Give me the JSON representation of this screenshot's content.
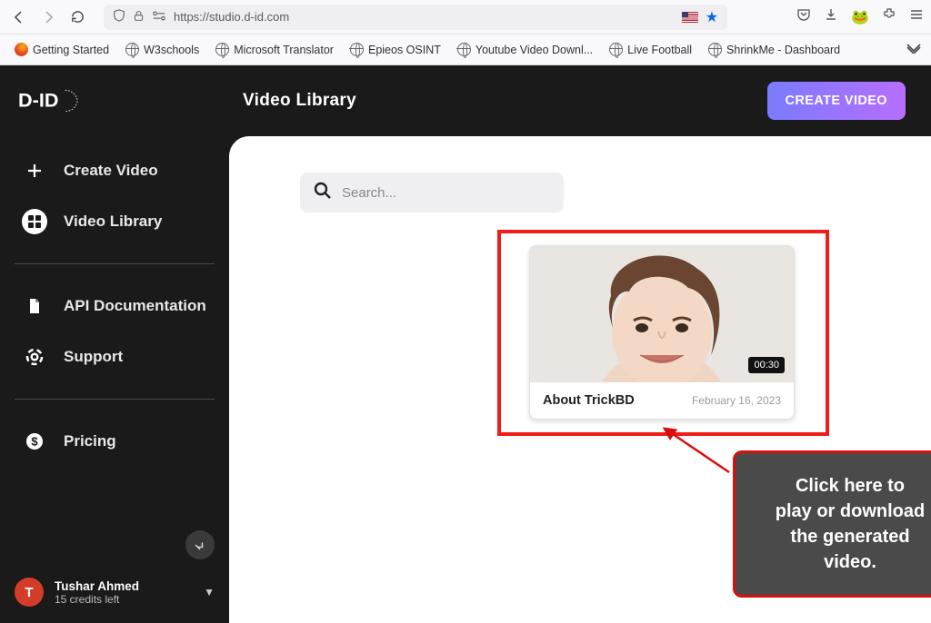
{
  "browser": {
    "url": "https://studio.d-id.com",
    "bookmarks": [
      {
        "label": "Getting Started",
        "type": "firefox"
      },
      {
        "label": "W3schools",
        "type": "globe"
      },
      {
        "label": "Microsoft Translator",
        "type": "globe"
      },
      {
        "label": "Epieos OSINT",
        "type": "globe"
      },
      {
        "label": "Youtube Video Downl...",
        "type": "globe"
      },
      {
        "label": "Live Football",
        "type": "globe"
      },
      {
        "label": "ShrinkMe - Dashboard",
        "type": "globe"
      }
    ]
  },
  "header": {
    "title": "Video Library",
    "create_button": "CREATE VIDEO"
  },
  "sidebar": {
    "items": [
      {
        "label": "Create Video"
      },
      {
        "label": "Video Library"
      },
      {
        "label": "API Documentation"
      },
      {
        "label": "Support"
      },
      {
        "label": "Pricing"
      }
    ]
  },
  "user": {
    "initial": "T",
    "name": "Tushar Ahmed",
    "credits": "15 credits left"
  },
  "search": {
    "placeholder": "Search..."
  },
  "video": {
    "title": "About TrickBD",
    "date": "February 16, 2023",
    "duration": "00:30"
  },
  "callout": {
    "line1": "Click here to",
    "line2": "play or download",
    "line3": "the generated",
    "line4": "video."
  }
}
